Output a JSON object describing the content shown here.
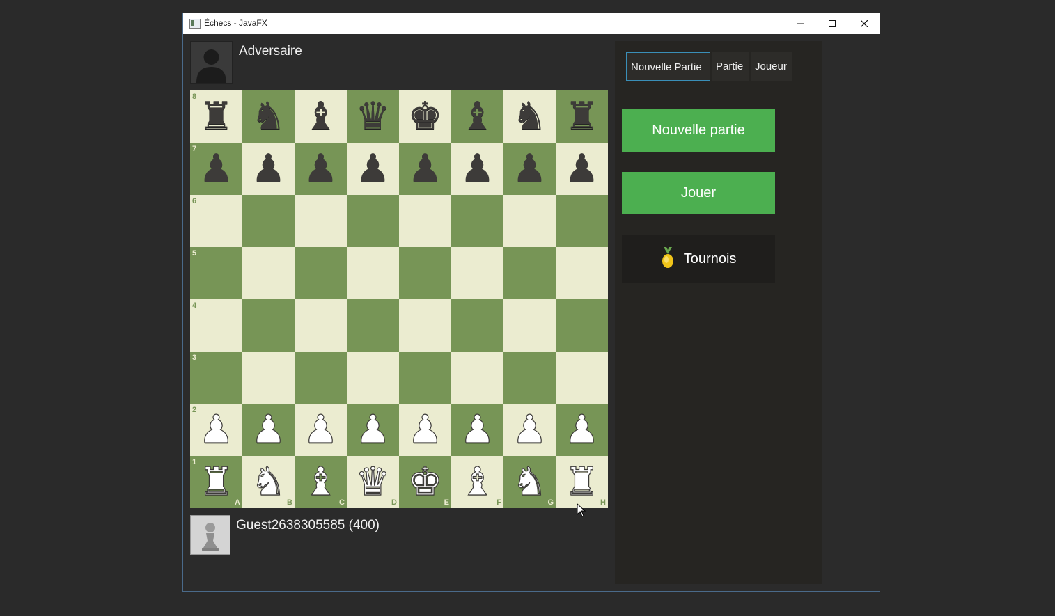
{
  "window": {
    "title": "Échecs - JavaFX"
  },
  "opponent": {
    "name": "Adversaire"
  },
  "player": {
    "name": "Guest2638305585 (400)"
  },
  "tabs": [
    {
      "label": "Nouvelle Partie",
      "active": true
    },
    {
      "label": "Partie",
      "active": false
    },
    {
      "label": "Joueur",
      "active": false
    }
  ],
  "actions": {
    "new_game": "Nouvelle partie",
    "play": "Jouer",
    "tournament": "Tournois"
  },
  "board": {
    "ranks": [
      "8",
      "7",
      "6",
      "5",
      "4",
      "3",
      "2",
      "1"
    ],
    "files": [
      "A",
      "B",
      "C",
      "D",
      "E",
      "F",
      "G",
      "H"
    ],
    "rows": [
      [
        "br",
        "bn",
        "bb",
        "bq",
        "bk",
        "bb",
        "bn",
        "br"
      ],
      [
        "bp",
        "bp",
        "bp",
        "bp",
        "bp",
        "bp",
        "bp",
        "bp"
      ],
      [
        "",
        "",
        "",
        "",
        "",
        "",
        "",
        ""
      ],
      [
        "",
        "",
        "",
        "",
        "",
        "",
        "",
        ""
      ],
      [
        "",
        "",
        "",
        "",
        "",
        "",
        "",
        ""
      ],
      [
        "",
        "",
        "",
        "",
        "",
        "",
        "",
        ""
      ],
      [
        "wp",
        "wp",
        "wp",
        "wp",
        "wp",
        "wp",
        "wp",
        "wp"
      ],
      [
        "wr",
        "wn",
        "wb",
        "wq",
        "wk",
        "wb",
        "wn",
        "wr"
      ]
    ],
    "light_color": "#ebecd0",
    "dark_color": "#779556"
  },
  "colors": {
    "accent": "#4caf50",
    "panel": "#262522",
    "tab_focus": "#3a8fb8"
  }
}
